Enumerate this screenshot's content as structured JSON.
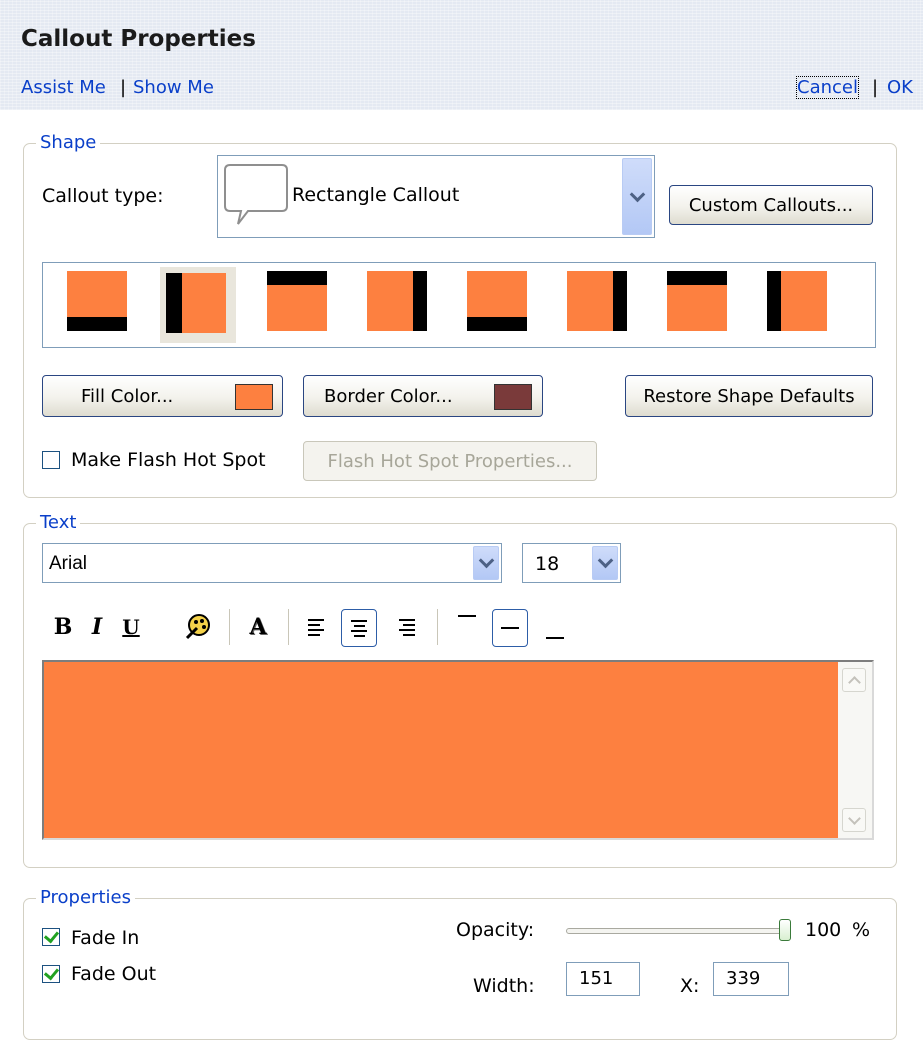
{
  "header": {
    "title": "Callout Properties",
    "assist_me": "Assist Me",
    "separator": "|",
    "show_me": "Show Me",
    "cancel": "Cancel",
    "ok": "OK"
  },
  "shape": {
    "legend": "Shape",
    "callout_type_label": "Callout type:",
    "callout_type_value": "Rectangle Callout",
    "custom_callouts_button": "Custom Callouts...",
    "fill_color_button": "Fill Color...",
    "fill_color": "#fd8040",
    "border_color_button": "Border Color...",
    "border_color": "#7a3a3a",
    "restore_defaults_button": "Restore Shape Defaults",
    "make_hotspot_label": "Make Flash Hot Spot",
    "make_hotspot_checked": false,
    "hotspot_properties_button": "Flash Hot Spot Properties...",
    "gallery_selected_index": 1
  },
  "text": {
    "legend": "Text",
    "font_value": "Arial",
    "size_value": "18",
    "toolbar": [
      "bold-button",
      "italic-button",
      "underline-button",
      "link-button",
      "text-color-button",
      "align-left-button",
      "align-center-button",
      "align-right-button",
      "valign-top-button",
      "valign-middle-button",
      "valign-bottom-button"
    ],
    "bold_glyph": "B",
    "italic_glyph": "I",
    "underline_glyph": "U",
    "color_glyph": "A",
    "content": "",
    "background": "#fd8040"
  },
  "properties": {
    "legend": "Properties",
    "fade_in_label": "Fade In",
    "fade_in_checked": true,
    "fade_out_label": "Fade Out",
    "fade_out_checked": true,
    "opacity_label": "Opacity:",
    "opacity_value": "100",
    "opacity_unit": "%",
    "width_label": "Width:",
    "width_value": "151",
    "x_label": "X:",
    "x_value": "339"
  }
}
